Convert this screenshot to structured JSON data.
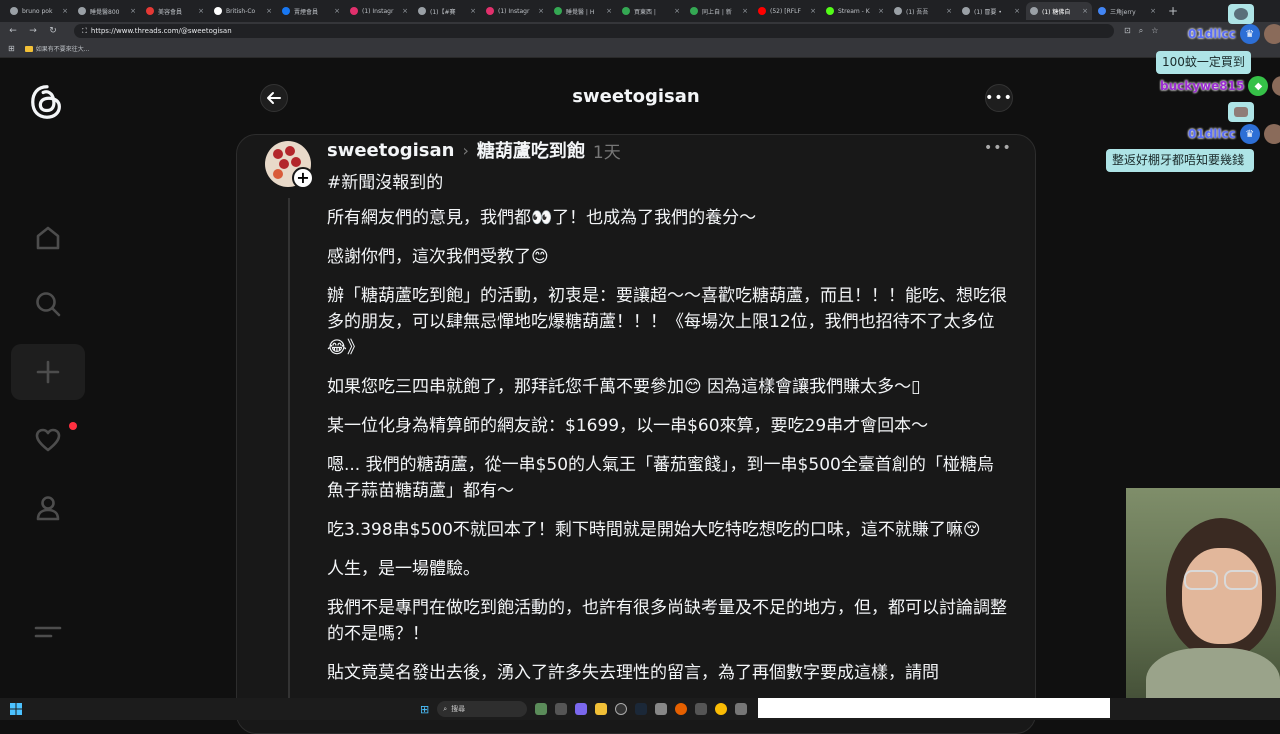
{
  "browser": {
    "tabs": [
      {
        "label": "bruno pok",
        "color": "#9aa0a6"
      },
      {
        "label": "睡覺醫800",
        "color": "#9aa0a6"
      },
      {
        "label": "美容會員",
        "color": "#e53935"
      },
      {
        "label": "British-Co",
        "color": "#ffffff"
      },
      {
        "label": "賣煙會員",
        "color": "#1877f2"
      },
      {
        "label": "(1) Instagr",
        "color": "#e1306c"
      },
      {
        "label": "(1)【#賽",
        "color": "#9aa0a6"
      },
      {
        "label": "(1) Instagr",
        "color": "#e1306c"
      },
      {
        "label": "睡覺醫 | H",
        "color": "#34a853"
      },
      {
        "label": "買東西 |",
        "color": "#34a853"
      },
      {
        "label": "同上自 | 新",
        "color": "#34a853"
      },
      {
        "label": "(52) [RFLF",
        "color": "#ff0000"
      },
      {
        "label": "Stream - K",
        "color": "#53fc18"
      },
      {
        "label": "(1) 吾吾",
        "color": "#9aa0a6"
      },
      {
        "label": "(1) 冒要 •",
        "color": "#9aa0a6"
      },
      {
        "label": "(1) 糖佛自",
        "color": "#9aa0a6"
      },
      {
        "label": "三角jerry",
        "color": "#4285f4"
      }
    ],
    "active_tab_index": 15,
    "url": "https://www.threads.com/@sweetogisan",
    "bookmark_folder": "如果有不要來往大..."
  },
  "header": {
    "title": "sweetogisan"
  },
  "post": {
    "username": "sweetogisan",
    "topic": "糖葫蘆吃到飽",
    "time": "1天",
    "hashtag": "#新聞沒報到的",
    "paragraphs": [
      "所有網友們的意見，我們都👀了！也成為了我們的養分～",
      "感謝你們，這次我們受教了😊",
      "辦「糖葫蘆吃到飽」的活動，初衷是：要讓超～～喜歡吃糖葫蘆，而且！！！能吃、想吃很多的朋友，可以肆無忌憚地吃爆糖葫蘆！！！《每場次上限12位，我們也招待不了太多位😂》",
      "如果您吃三四串就飽了，那拜託您千萬不要參加😊 因為這樣會讓我們賺太多～▯",
      "某一位化身為精算師的網友說：$1699，以一串$60來算，要吃29串才會回本～",
      "嗯... 我們的糖葫蘆，從一串$50的人氣王「蕃茄蜜餞」，到一串$500全臺首創的「椪糖烏魚子蒜苗糖葫蘆」都有～",
      "吃3.398串$500不就回本了！剩下時間就是開始大吃特吃想吃的口味，這不就賺了嘛😚",
      "人生，是一場體驗。",
      "我們不是專門在做吃到飽活動的，也許有很多尚缺考量及不足的地方，但，都可以討論調整的不是嗎？！",
      "貼文竟莫名發出去後，湧入了許多失去理性的留言，為了再個數字要成這樣，請問"
    ]
  },
  "chat": {
    "messages": [
      {
        "user": "01dllcc",
        "text": "100蚊一定買到"
      },
      {
        "user": "buckywe815",
        "text": ""
      },
      {
        "user": "01dllcc",
        "text": "整返好棚牙都唔知要幾錢"
      }
    ]
  },
  "taskbar": {
    "search_label": "搜尋"
  },
  "colors": {
    "accent": "#ff3040",
    "background": "#101010",
    "card": "#181818"
  }
}
